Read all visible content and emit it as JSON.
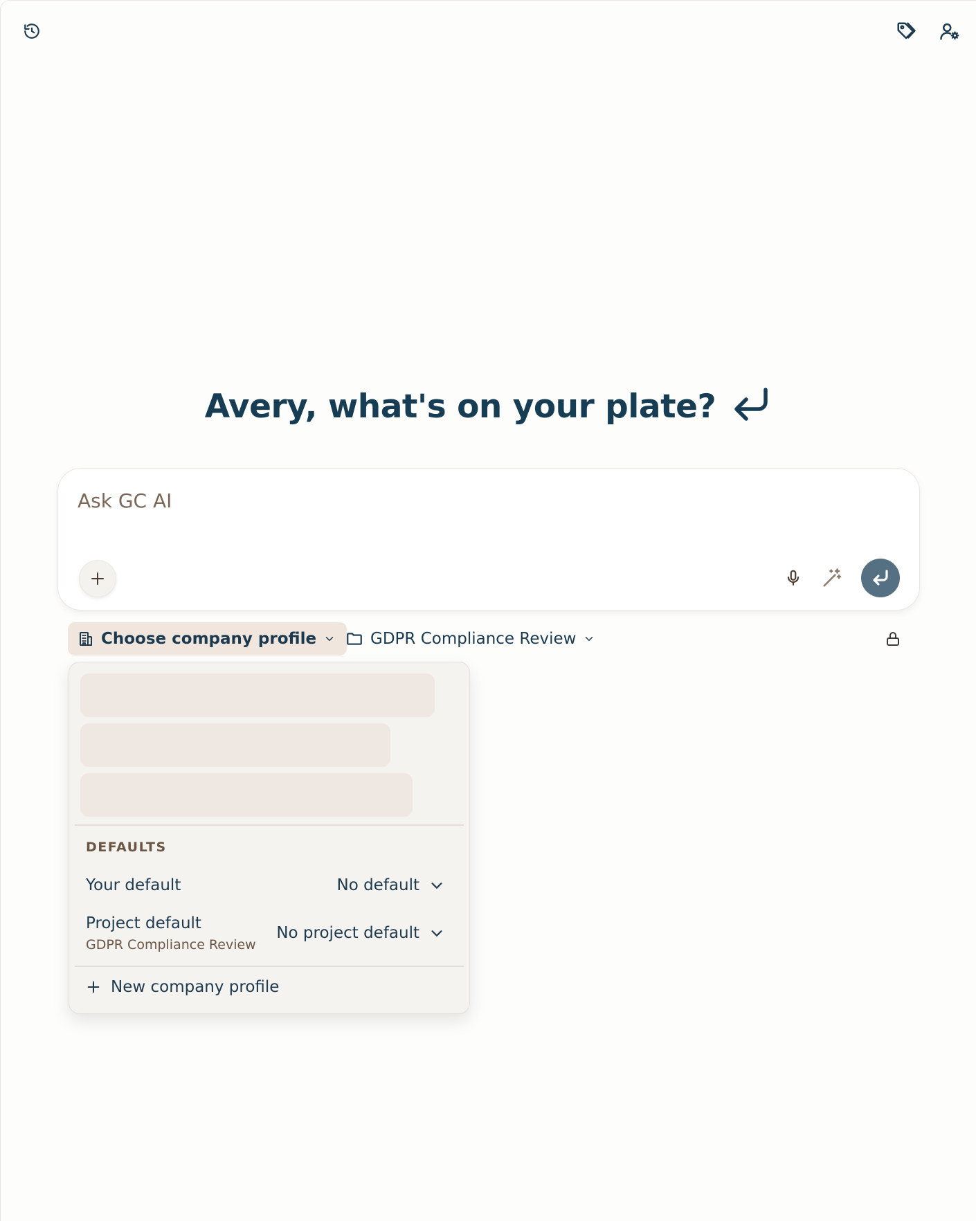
{
  "header": {
    "history_icon": "history-icon",
    "tags_icon": "tag-icon",
    "user_settings_icon": "user-settings-icon"
  },
  "greeting": {
    "text": "Avery, what's on your plate?",
    "icon": "return-arrow-icon"
  },
  "composer": {
    "placeholder": "Ask GC AI",
    "value": "",
    "add_icon": "plus-icon",
    "mic_icon": "microphone-icon",
    "enhance_icon": "magic-wand-icon",
    "send_icon": "return-arrow-icon",
    "send_color": "#567083"
  },
  "toolbar": {
    "company_profile_label": "Choose company profile",
    "project_label": "GDPR Compliance Review",
    "lock_icon": "lock-icon",
    "chip_active_color": "#f0e6de"
  },
  "dropdown": {
    "loading_placeholders": 3,
    "section_label": "DEFAULTS",
    "your_default": {
      "label": "Your default",
      "value": "No default"
    },
    "project_default": {
      "label": "Project default",
      "sublabel": "GDPR Compliance Review",
      "value": "No project default"
    },
    "new_profile_label": "New company profile"
  }
}
